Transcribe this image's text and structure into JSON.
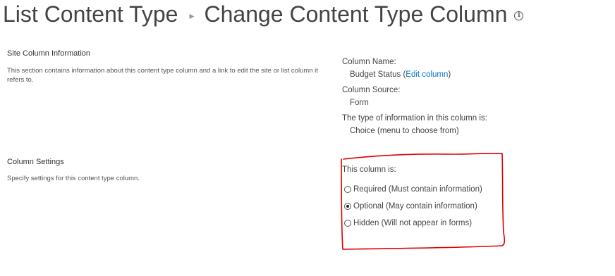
{
  "header": {
    "breadcrumb": "List Content Type",
    "separator": "▸",
    "title": "Change Content Type Column",
    "info_icon": "info-circle-icon"
  },
  "site_column_info": {
    "heading": "Site Column Information",
    "description": "This section contains information about this content type column and a link to edit the site or list column it refers to.",
    "column_name_label": "Column Name:",
    "column_name_value": "Budget Status",
    "edit_link_open": "(",
    "edit_link": "Edit column",
    "edit_link_close": ")",
    "column_source_label": "Column Source:",
    "column_source_value": "Form",
    "type_label": "The type of information in this column is:",
    "type_value": "Choice (menu to choose from)"
  },
  "column_settings": {
    "heading": "Column Settings",
    "description": "Specify settings for this content type column.",
    "prompt": "This column is:",
    "options": [
      {
        "label": "Required (Must contain information)",
        "checked": false
      },
      {
        "label": "Optional (May contain information)",
        "checked": true
      },
      {
        "label": "Hidden (Will not appear in forms)",
        "checked": false
      }
    ]
  },
  "colors": {
    "link": "#0072c6",
    "annotation": "#e00000",
    "text": "#444444"
  }
}
